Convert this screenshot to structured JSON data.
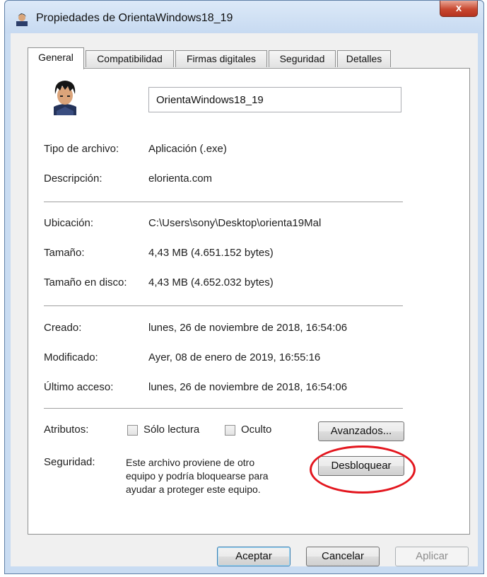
{
  "window": {
    "title": "Propiedades de OrientaWindows18_19",
    "close_label": "x",
    "title_icon": "user-avatar-icon"
  },
  "tabs": [
    {
      "label": "General",
      "active": true
    },
    {
      "label": "Compatibilidad",
      "active": false
    },
    {
      "label": "Firmas digitales",
      "active": false
    },
    {
      "label": "Seguridad",
      "active": false
    },
    {
      "label": "Detalles",
      "active": false
    }
  ],
  "general": {
    "file_name": "OrientaWindows18_19",
    "file_type_label": "Tipo de archivo:",
    "file_type_value": "Aplicación (.exe)",
    "description_label": "Descripción:",
    "description_value": "elorienta.com",
    "location_label": "Ubicación:",
    "location_value": "C:\\Users\\sony\\Desktop\\orienta19Mal",
    "size_label": "Tamaño:",
    "size_value": "4,43 MB (4.651.152 bytes)",
    "disk_size_label": "Tamaño en disco:",
    "disk_size_value": "4,43 MB (4.652.032 bytes)",
    "created_label": "Creado:",
    "created_value": "lunes, 26 de noviembre de 2018, 16:54:06",
    "modified_label": "Modificado:",
    "modified_value": "Ayer, 08 de enero de 2019, 16:55:16",
    "accessed_label": "Último acceso:",
    "accessed_value": "lunes, 26 de noviembre de 2018, 16:54:06",
    "attributes_label": "Atributos:",
    "readonly_label": "Sólo lectura",
    "readonly_checked": false,
    "hidden_label": "Oculto",
    "hidden_checked": false,
    "advanced_button": "Avanzados...",
    "security_label": "Seguridad:",
    "security_text_lines": [
      "Este archivo proviene de otro",
      "equipo y podría bloquearse para",
      "ayudar a proteger este equipo."
    ],
    "unblock_button": "Desbloquear"
  },
  "footer": {
    "ok": "Aceptar",
    "cancel": "Cancelar",
    "apply": "Aplicar"
  },
  "colors": {
    "highlight_ellipse": "#e3161e",
    "window_frame": "#c9dcf2"
  }
}
